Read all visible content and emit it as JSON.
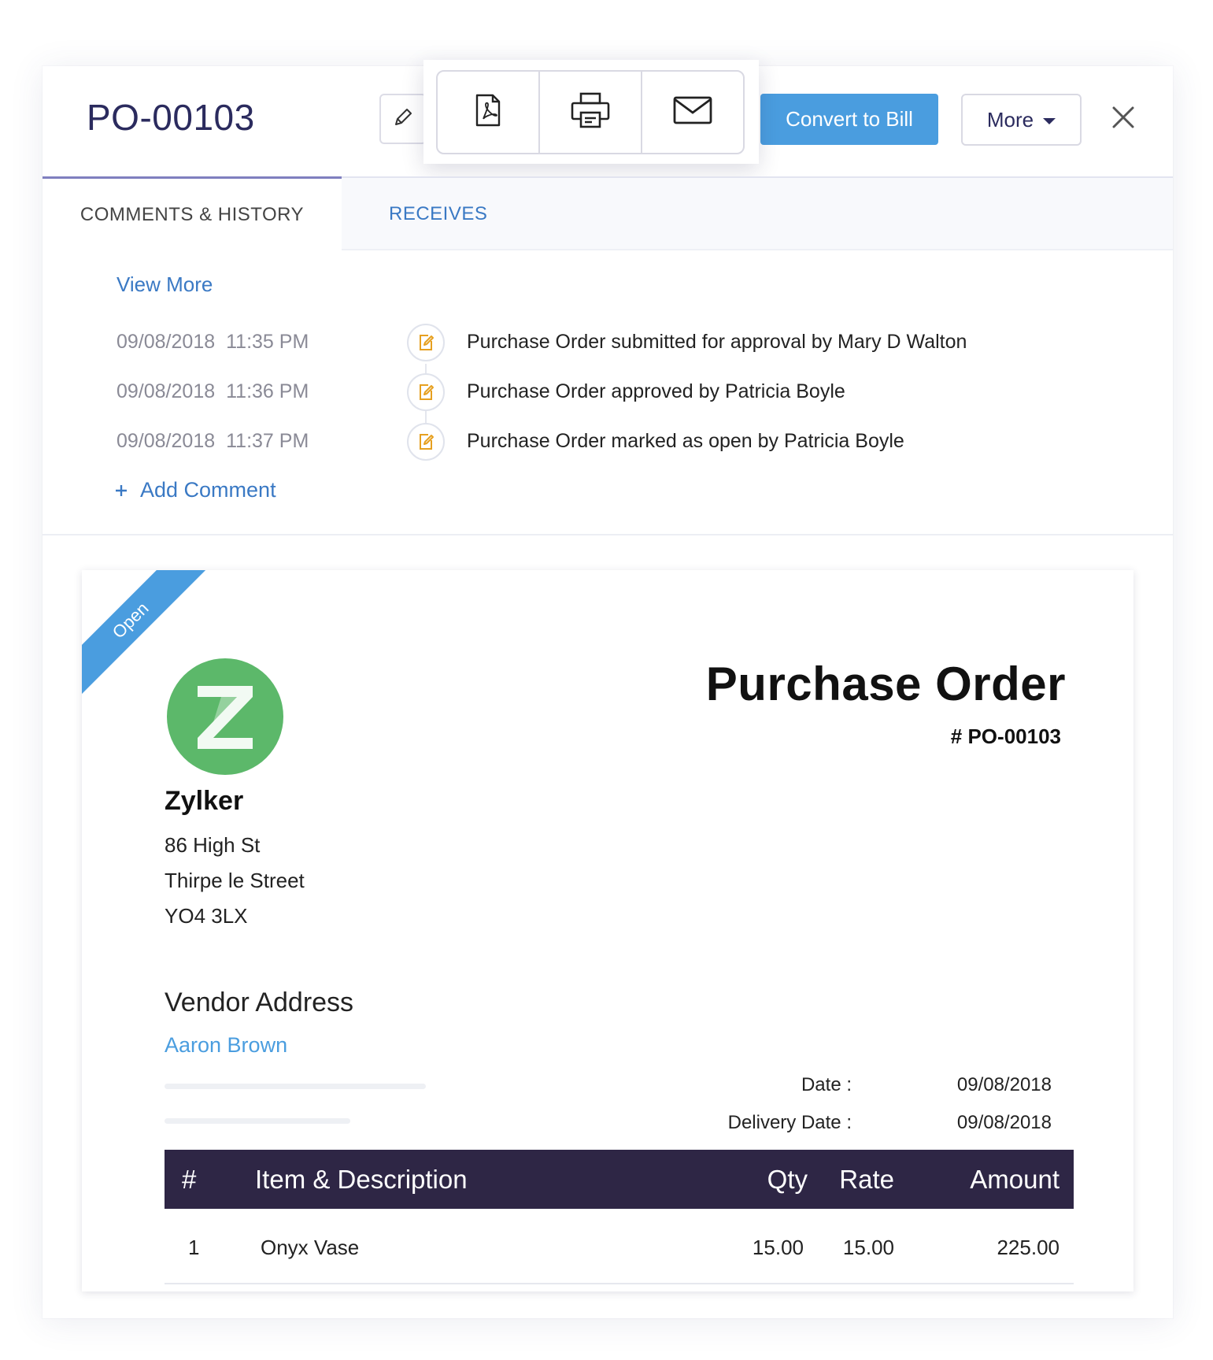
{
  "header": {
    "po_number": "PO-00103",
    "convert_label": "Convert to Bill",
    "more_label": "More"
  },
  "tabs": [
    {
      "label": "COMMENTS & HISTORY",
      "active": true
    },
    {
      "label": "RECEIVES",
      "active": false
    }
  ],
  "history": {
    "view_more": "View More",
    "entries": [
      {
        "date": "09/08/2018",
        "time": "11:35 PM",
        "text": "Purchase Order submitted for approval by Mary D Walton"
      },
      {
        "date": "09/08/2018",
        "time": "11:36 PM",
        "text": "Purchase Order approved by Patricia Boyle"
      },
      {
        "date": "09/08/2018",
        "time": "11:37 PM",
        "text": "Purchase Order marked as open by Patricia Boyle"
      }
    ],
    "add_comment": "Add Comment"
  },
  "document": {
    "status": "Open",
    "logo_letter": "Z",
    "company": "Zylker",
    "address": [
      "86 High St",
      "Thirpe le Street",
      "YO4 3LX"
    ],
    "title": "Purchase Order",
    "number": "# PO-00103",
    "vendor_heading": "Vendor Address",
    "vendor_name": "Aaron Brown",
    "date_label": "Date :",
    "date_value": "09/08/2018",
    "delivery_label": "Delivery Date :",
    "delivery_value": "09/08/2018",
    "table": {
      "headers": [
        "#",
        "Item & Description",
        "Qty",
        "Rate",
        "Amount"
      ],
      "rows": [
        [
          "1",
          "Onyx Vase",
          "15.00",
          "15.00",
          "225.00"
        ]
      ]
    }
  },
  "colors": {
    "accent": "#4a9ddf",
    "title": "#2b2b5e",
    "link": "#3a79c4",
    "table_header": "#2e2645",
    "logo": "#5cb86a"
  },
  "icons": [
    "edit-icon",
    "pdf-icon",
    "print-icon",
    "email-icon",
    "close-icon",
    "history-edit-icon",
    "plus-icon"
  ]
}
